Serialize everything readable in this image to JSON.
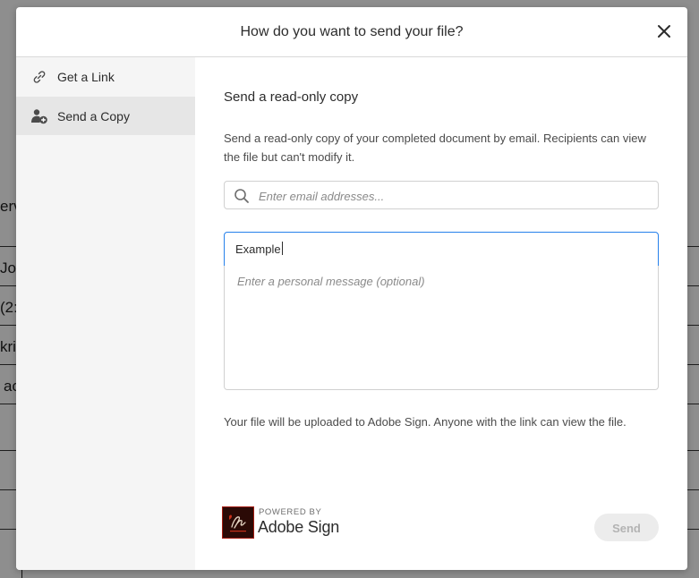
{
  "background_fragments": [
    "erv",
    "Jo",
    "(2:",
    "kri",
    "ac"
  ],
  "dialog": {
    "title": "How do you want to send your file?",
    "close_icon": "close-icon"
  },
  "sidebar": {
    "items": [
      {
        "label": "Get a Link",
        "icon": "link-icon",
        "active": false
      },
      {
        "label": "Send a Copy",
        "icon": "user-add-icon",
        "active": true
      }
    ]
  },
  "main": {
    "section_title": "Send a read-only copy",
    "description": "Send a read-only copy of your completed document by email. Recipients can view the file but can't modify it.",
    "email_search": {
      "placeholder": "Enter email addresses...",
      "value": ""
    },
    "subject": {
      "value": "Example"
    },
    "message": {
      "placeholder": "Enter a personal message (optional)",
      "value": ""
    },
    "upload_note": "Your file will be uploaded to Adobe Sign. Anyone with the link can view the file."
  },
  "footer": {
    "powered_by": "POWERED BY",
    "brand": "Adobe Sign",
    "send_label": "Send",
    "send_enabled": false
  },
  "colors": {
    "accent": "#2680eb",
    "brand_logo_bg": "#2b0a06",
    "brand_logo_mark": "#c7301a"
  }
}
